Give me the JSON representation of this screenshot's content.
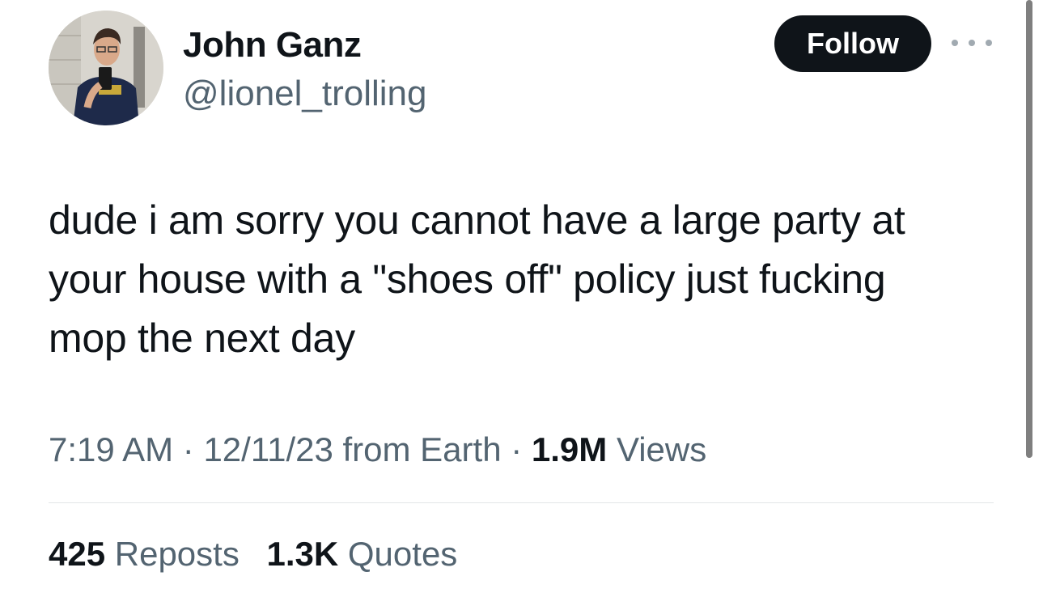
{
  "author": {
    "display_name": "John Ganz",
    "handle": "@lionel_trolling"
  },
  "actions": {
    "follow_label": "Follow",
    "more_icon": "more-horizontal-icon"
  },
  "tweet": {
    "text_lines": [
      "dude i am sorry you cannot have a large party at",
      "your house with a \"shoes off\" policy just fucking",
      "mop the next day"
    ],
    "time": "7:19 AM",
    "date": "12/11/23",
    "source": "from Earth",
    "separator": "·",
    "views_count": "1.9M",
    "views_label": "Views"
  },
  "stats": {
    "reposts_count": "425",
    "reposts_label": "Reposts",
    "quotes_count": "1.3K",
    "quotes_label": "Quotes"
  },
  "colors": {
    "text_primary": "#0f1419",
    "text_secondary": "#536471",
    "button_bg": "#0f1419",
    "divider": "#e3e6e8"
  }
}
